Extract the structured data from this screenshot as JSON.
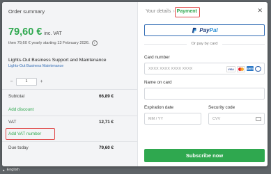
{
  "summary": {
    "title": "Order summary",
    "price": "79,60 €",
    "price_suffix": "inc. VAT",
    "renewal": "then 79,60 € yearly starting 13 February 2026.",
    "info_glyph": "i",
    "product_name": "Lights-Out Business Support and Maintenance",
    "product_link": "Lights-Out Business Maintenance",
    "quantity": "1",
    "minus": "−",
    "plus": "+",
    "subtotal_label": "Subtotal",
    "subtotal_value": "66,89 €",
    "add_discount": "Add discount",
    "vat_label": "VAT",
    "vat_value": "12,71 €",
    "add_vat_number": "Add VAT number",
    "due_label": "Due today",
    "due_value": "79,60 €"
  },
  "checkout": {
    "step1": "Your details",
    "step_sep": "›",
    "step2": "Payment",
    "close": "✕",
    "paypal_pay": "Pay",
    "paypal_pal": "Pal",
    "or_text": "Or pay by card",
    "card_number_label": "Card number",
    "card_number_placeholder": "XXXX XXXX XXXX XXXX",
    "brands": {
      "visa": "VISA",
      "amex": "AMEX"
    },
    "name_label": "Name on card",
    "expiry_label": "Expiration date",
    "expiry_placeholder": "MM / YY",
    "security_label": "Security code",
    "cvv_placeholder": "CVV",
    "subscribe": "Subscribe now"
  },
  "footer": {
    "language": "English",
    "caret": "▲"
  },
  "colors": {
    "accent": "#2fa84f",
    "paypal_dark": "#1b3a7a",
    "paypal_light": "#2c8fd6",
    "highlight": "#e04848"
  }
}
